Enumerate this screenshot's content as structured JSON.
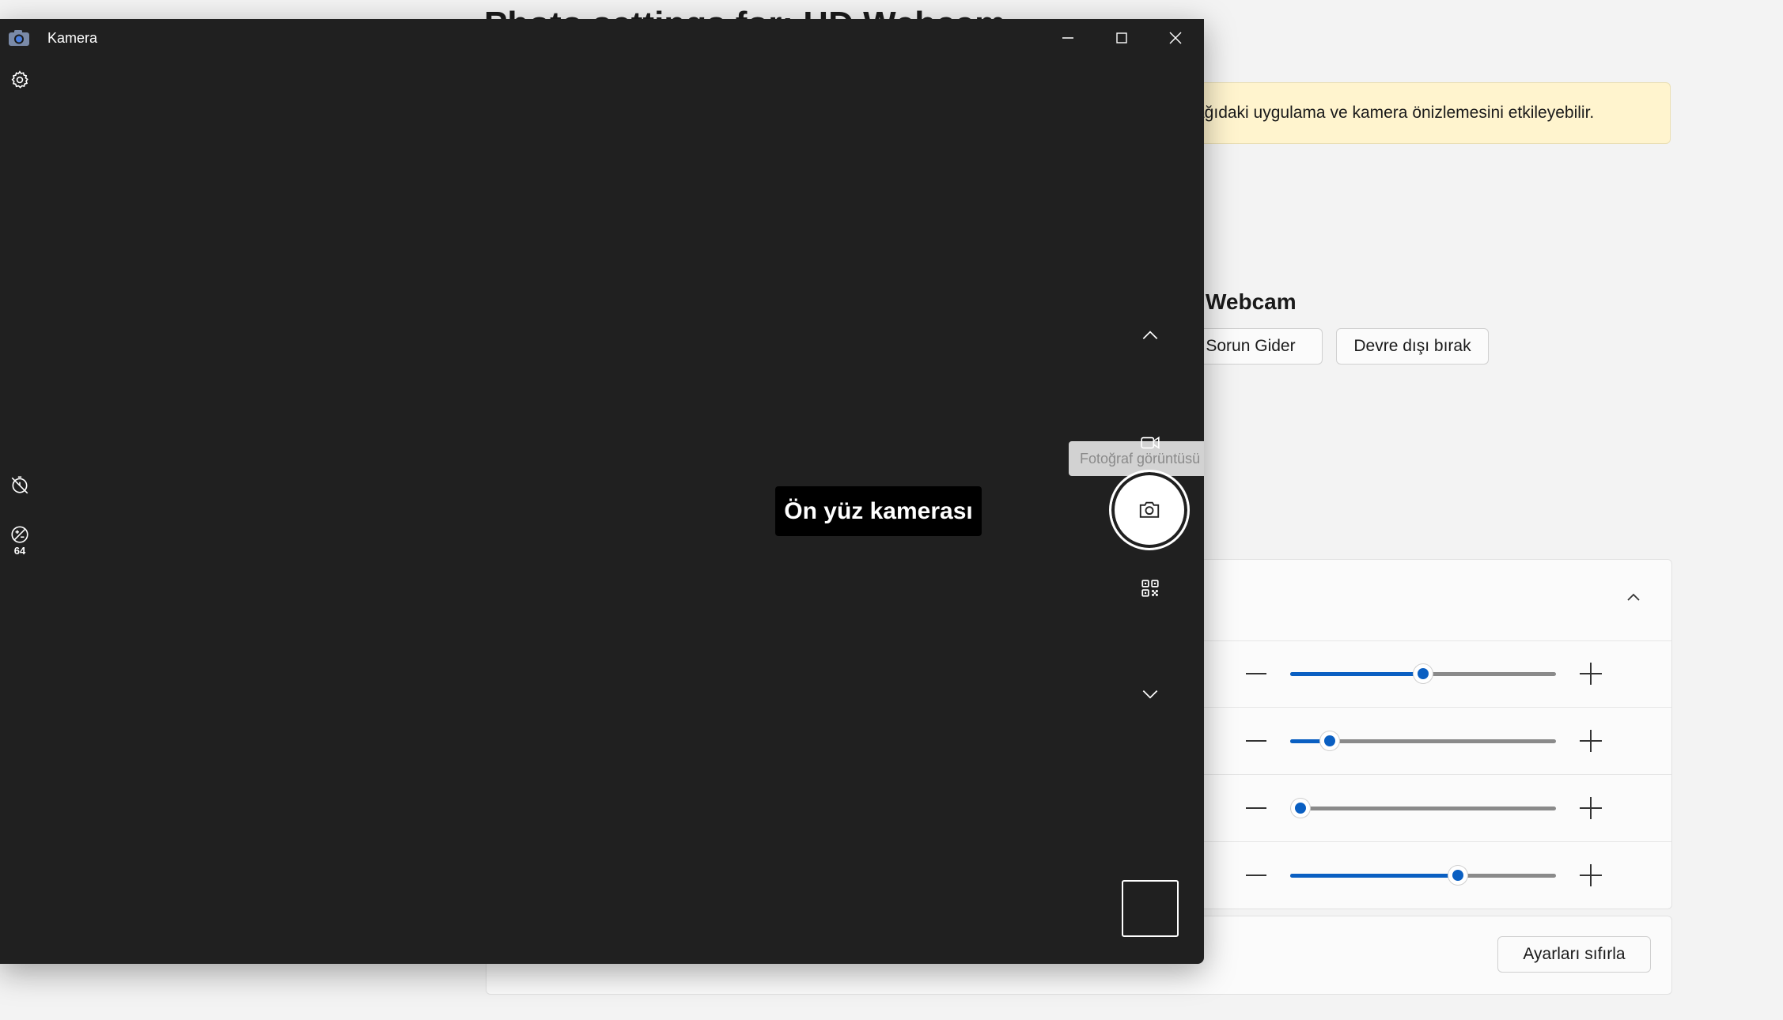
{
  "settings_page": {
    "title": "Photo settings for: HD Webcam",
    "warning_text": "ağıdaki uygulama ve kamera önizlemesini etkileyebilir.",
    "device_name": "Webcam",
    "troubleshoot_label": "Sorun Gider",
    "disable_label": "Devre dışı bırak",
    "sliders": [
      {
        "level_percent": 50
      },
      {
        "level_percent": 15
      },
      {
        "level_percent": 4
      },
      {
        "level_percent": 63
      }
    ],
    "reset_label": "Ayarları sıfırla"
  },
  "camera_app": {
    "title": "Kamera",
    "video_mode_tooltip": "Fotoğraf görüntüsü al",
    "exposure_value": "64",
    "toast": "Ön yüz kamerası",
    "icons": {
      "app": "camera-app-icon",
      "settings": "gear-icon",
      "timer": "timer-off-icon",
      "exposure": "exposure-icon",
      "mode_up": "chevron-up-icon",
      "video": "video-camera-icon",
      "shutter": "camera-icon",
      "qr": "qr-code-icon",
      "mode_down": "chevron-down-icon"
    }
  }
}
